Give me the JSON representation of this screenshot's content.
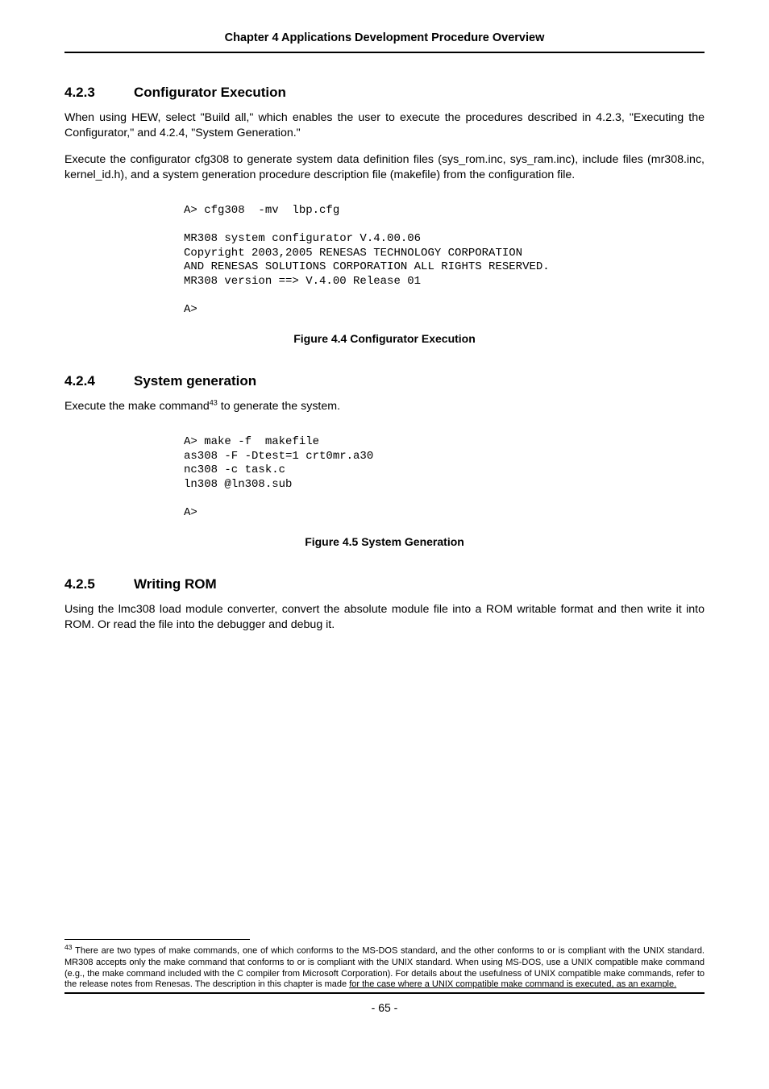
{
  "header": {
    "title": "Chapter 4 Applications Development Procedure Overview"
  },
  "section_423": {
    "number": "4.2.3",
    "title": "Configurator Execution",
    "para1": "When using HEW, select \"Build all,\" which enables the user to execute the procedures described in 4.2.3, \"Executing the Configurator,\" and 4.2.4, \"System Generation.\"",
    "para2": "Execute the configurator cfg308 to generate system data definition files (sys_rom.inc, sys_ram.inc), include files (mr308.inc, kernel_id.h), and a system generation procedure description file (makefile) from the configuration file.",
    "code": "A> cfg308  -mv  lbp.cfg\n\nMR308 system configurator V.4.00.06\nCopyright 2003,2005 RENESAS TECHNOLOGY CORPORATION\nAND RENESAS SOLUTIONS CORPORATION ALL RIGHTS RESERVED.\nMR308 version ==> V.4.00 Release 01\n\nA>",
    "figure": "Figure 4.4 Configurator Execution"
  },
  "section_424": {
    "number": "4.2.4",
    "title": "System generation",
    "para1_pre": "Execute the make command",
    "para1_sup": "43",
    "para1_post": " to generate the system.",
    "code": "A> make -f  makefile\nas308 -F -Dtest=1 crt0mr.a30\nnc308 -c task.c\nln308 @ln308.sub\n\nA>",
    "figure": "Figure 4.5 System Generation"
  },
  "section_425": {
    "number": "4.2.5",
    "title": "Writing ROM",
    "para1": "Using the lmc308 load module converter, convert the absolute module file into a ROM writable format and then write it into ROM. Or read the file into the debugger and debug it."
  },
  "footnote": {
    "ref": "43",
    "text_pre": " There are two types of make commands, one of which conforms to the MS-DOS standard, and the other conforms to or is compliant with the UNIX standard. MR308 accepts only the make command that conforms to or is compliant with the UNIX standard. When using MS-DOS, use a UNIX compatible make command (e.g., the make command included with the C compiler from Microsoft Corporation). For details about the usefulness of UNIX compatible make commands, refer to the release notes from Renesas. The description in this chapter is made ",
    "text_under": "for the case where a UNIX compatible make command is executed, as an example."
  },
  "footer": {
    "page": "- 65 -"
  }
}
